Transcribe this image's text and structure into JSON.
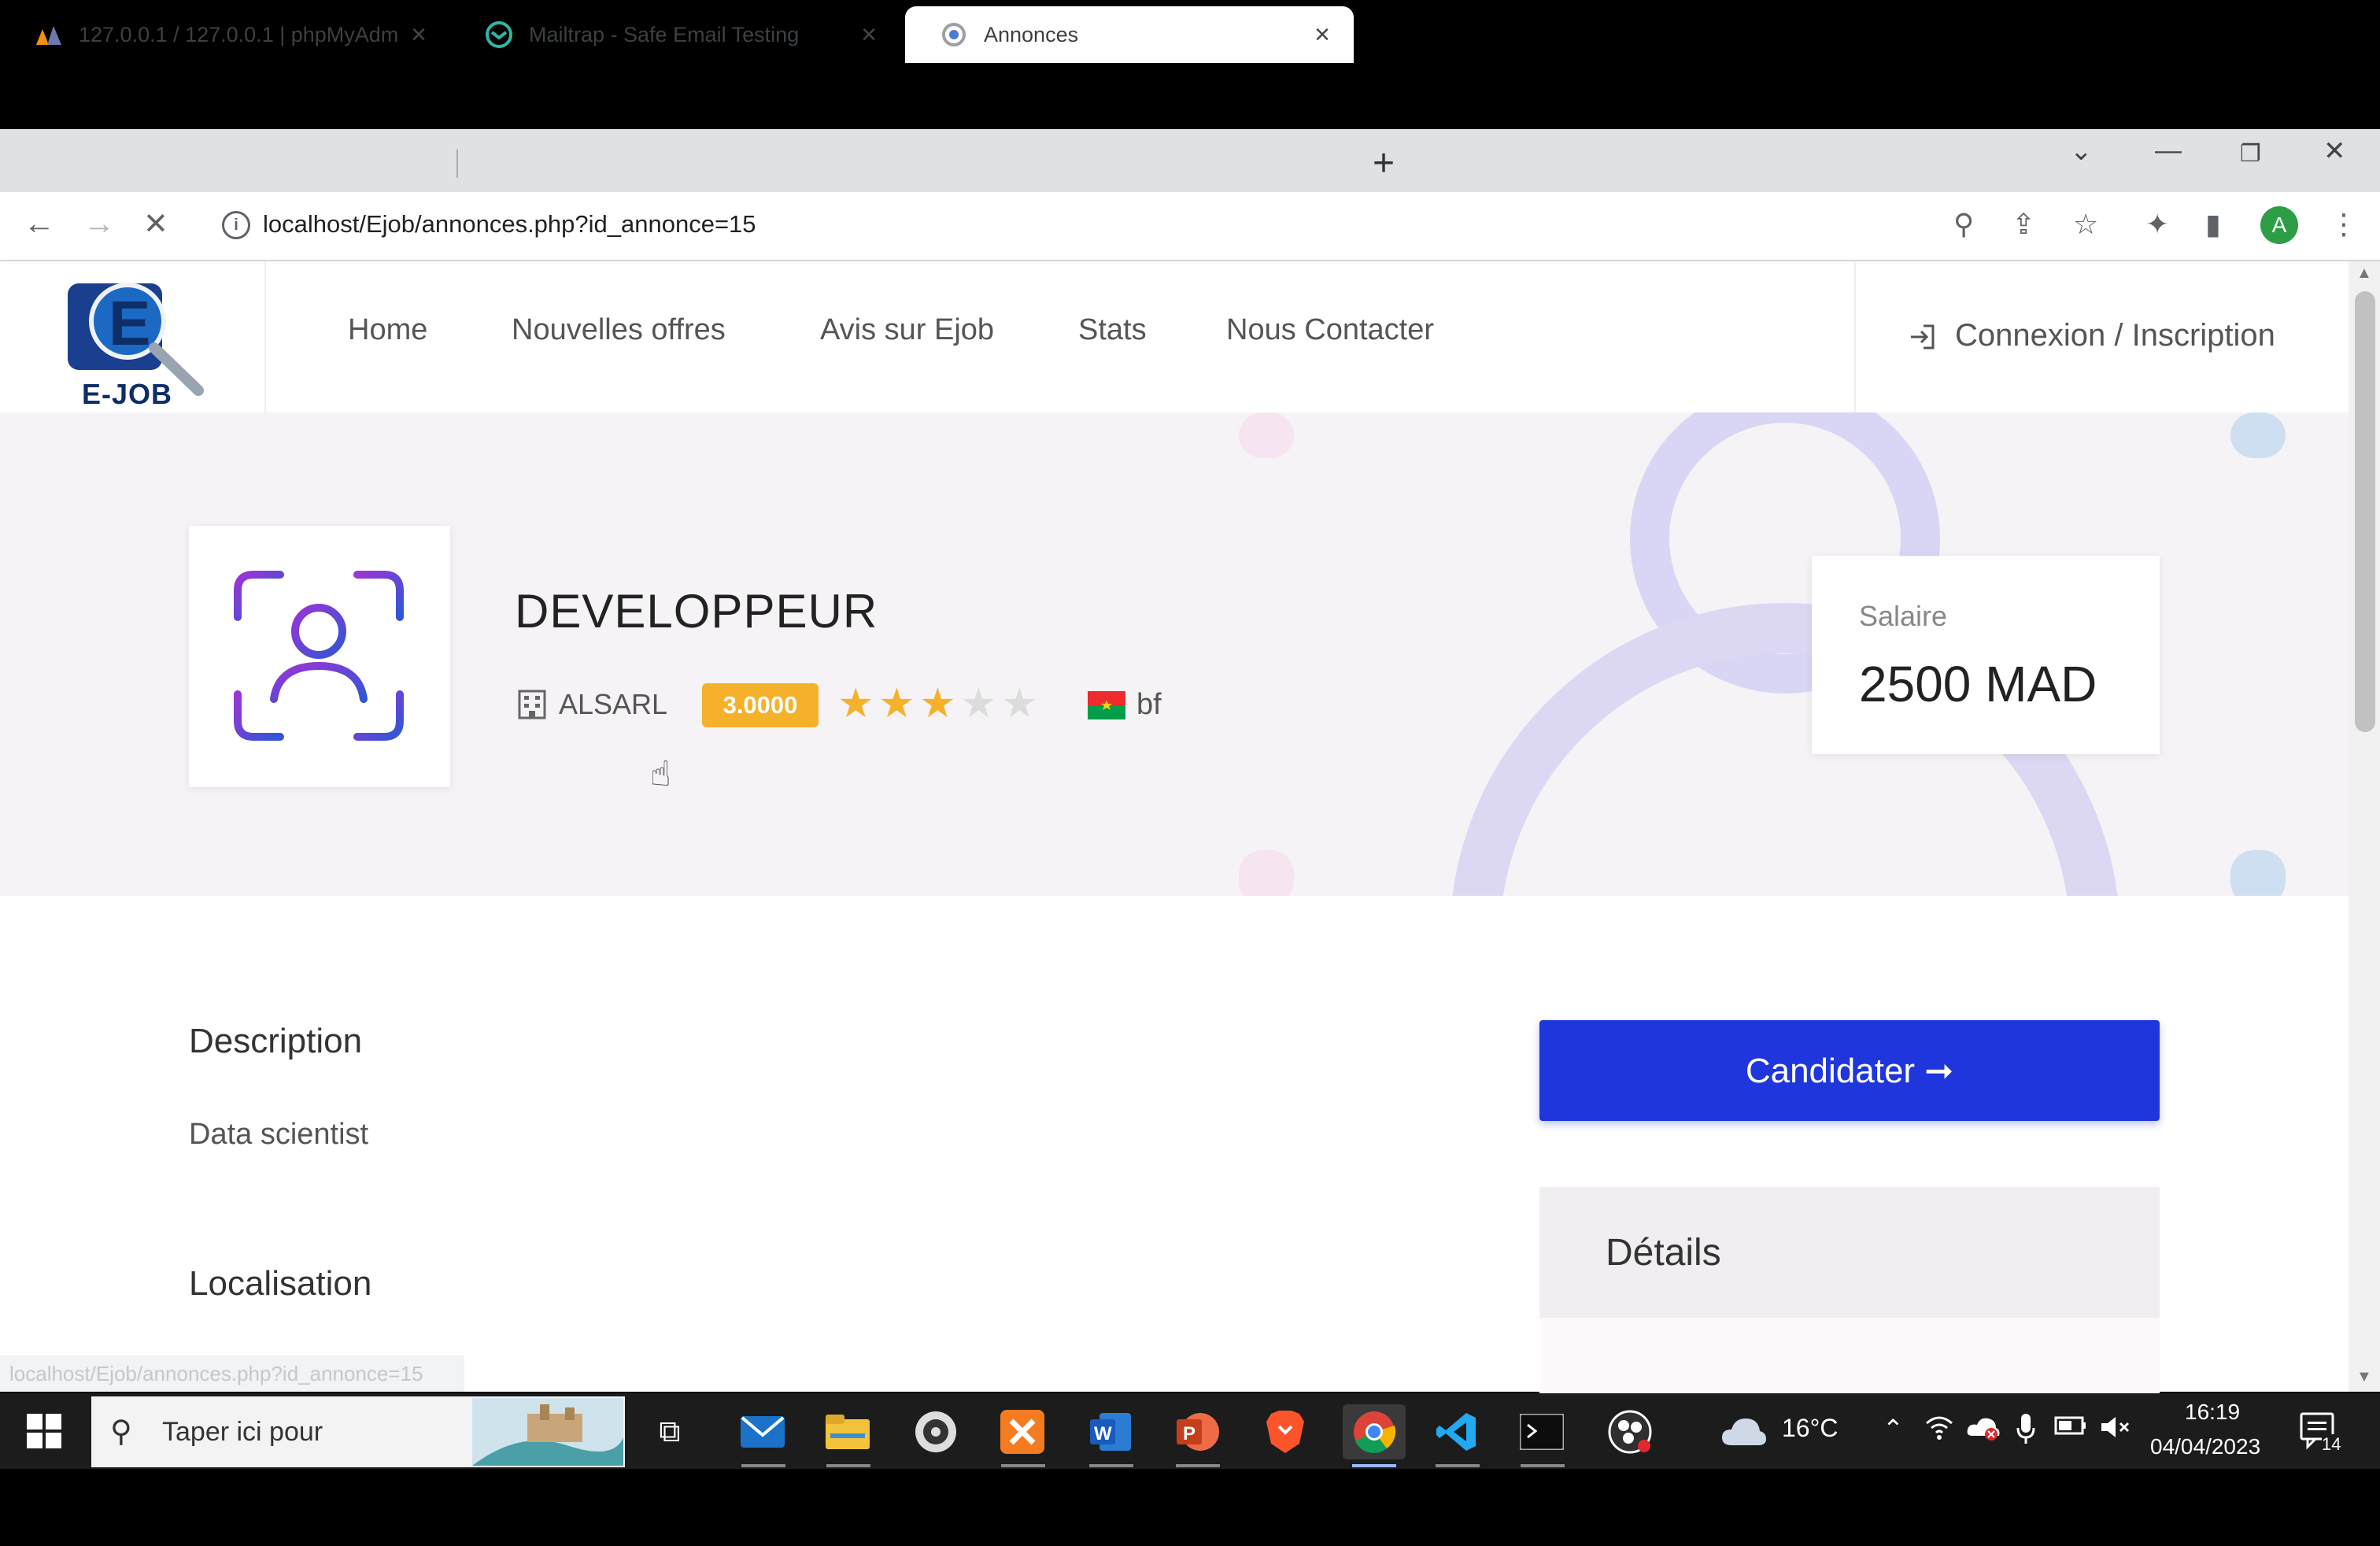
{
  "browser": {
    "tabs": [
      {
        "title": "127.0.0.1 / 127.0.0.1 | phpMyAdm",
        "favicon": "phpmyadmin-icon"
      },
      {
        "title": "Mailtrap - Safe Email Testing",
        "favicon": "mailtrap-icon"
      },
      {
        "title": "Annonces",
        "favicon": "loading-icon",
        "active": true
      }
    ],
    "url": "localhost/Ejob/annonces.php?id_annonce=15",
    "status_url": "localhost/Ejob/annonces.php?id_annonce=15",
    "profile_initial": "A"
  },
  "site": {
    "logo_text": "E-JOB",
    "nav": [
      "Home",
      "Nouvelles offres",
      "Avis sur Ejob",
      "Stats",
      "Nous Contacter"
    ],
    "login_label": "Connexion / Inscription"
  },
  "job": {
    "title": "DEVELOPPEUR",
    "company": "ALSARL",
    "rating": "3.0000",
    "stars_filled": 3,
    "stars_total": 5,
    "country": "bf",
    "salary_label": "Salaire",
    "salary_value": "2500 MAD"
  },
  "sections": {
    "description_title": "Description",
    "description_text": "Data scientist",
    "localisation_title": "Localisation",
    "apply_label": "Candidater ➞",
    "details_title": "Détails"
  },
  "taskbar": {
    "search_placeholder": "Taper ici pour",
    "weather": "16°C",
    "time": "16:19",
    "date": "04/04/2023",
    "notifications": "14"
  },
  "colors": {
    "primary_button": "#1f36dc",
    "rating_badge": "#f6b12a",
    "star_filled": "#f6b12a",
    "star_empty": "#dcdcdc"
  }
}
